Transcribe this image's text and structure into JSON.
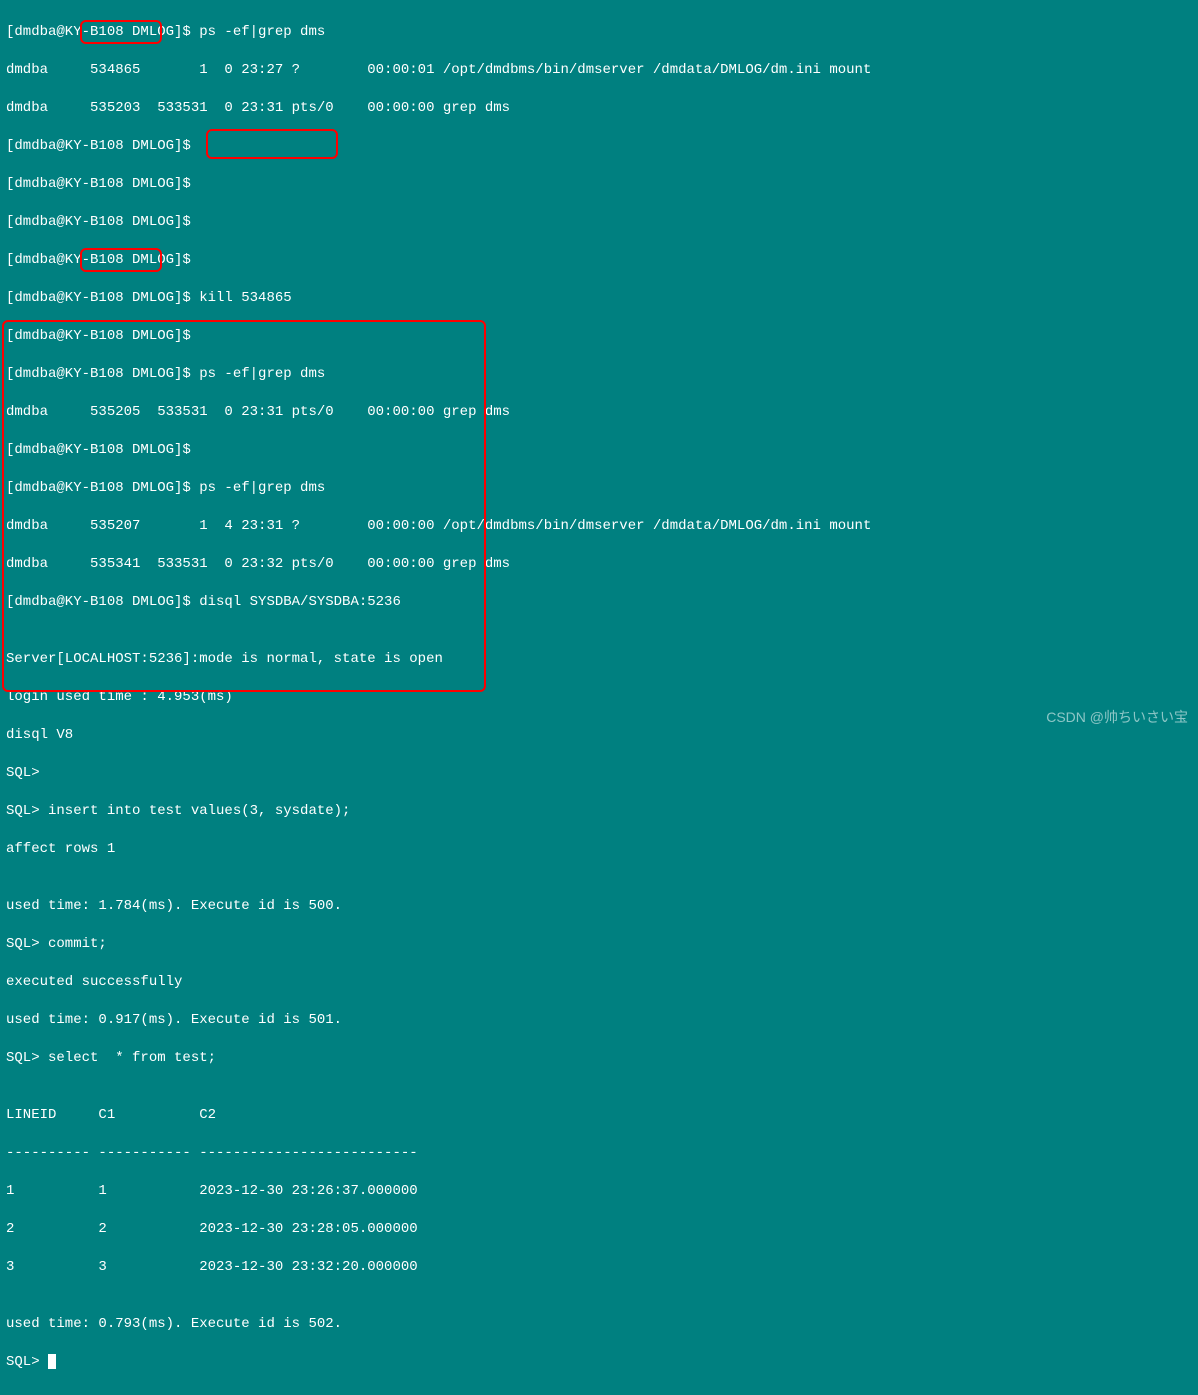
{
  "lines": {
    "l1": "[dmdba@KY-B108 DMLOG]$ ps -ef|grep dms",
    "l2": "dmdba     534865       1  0 23:27 ?        00:00:01 /opt/dmdbms/bin/dmserver /dmdata/DMLOG/dm.ini mount",
    "l3": "dmdba     535203  533531  0 23:31 pts/0    00:00:00 grep dms",
    "l4": "[dmdba@KY-B108 DMLOG]$ ",
    "l5": "[dmdba@KY-B108 DMLOG]$ ",
    "l6": "[dmdba@KY-B108 DMLOG]$ ",
    "l7": "[dmdba@KY-B108 DMLOG]$ ",
    "l8": "[dmdba@KY-B108 DMLOG]$ kill 534865",
    "l9": "[dmdba@KY-B108 DMLOG]$ ",
    "l10": "[dmdba@KY-B108 DMLOG]$ ps -ef|grep dms",
    "l11": "dmdba     535205  533531  0 23:31 pts/0    00:00:00 grep dms",
    "l12": "[dmdba@KY-B108 DMLOG]$ ",
    "l13": "[dmdba@KY-B108 DMLOG]$ ps -ef|grep dms",
    "l14": "dmdba     535207       1  4 23:31 ?        00:00:00 /opt/dmdbms/bin/dmserver /dmdata/DMLOG/dm.ini mount",
    "l15": "dmdba     535341  533531  0 23:32 pts/0    00:00:00 grep dms",
    "l16": "[dmdba@KY-B108 DMLOG]$ disql SYSDBA/SYSDBA:5236",
    "l17": "",
    "l18": "Server[LOCALHOST:5236]:mode is normal, state is open",
    "l19": "login used time : 4.953(ms)",
    "l20": "disql V8",
    "l21": "SQL> ",
    "l22": "SQL> insert into test values(3, sysdate);",
    "l23": "affect rows 1",
    "l24": "",
    "l25": "used time: 1.784(ms). Execute id is 500.",
    "l26": "SQL> commit;",
    "l27": "executed successfully",
    "l28": "used time: 0.917(ms). Execute id is 501.",
    "l29": "SQL> select  * from test;",
    "l30": "",
    "l31": "LINEID     C1          C2                        ",
    "l32": "---------- ----------- --------------------------",
    "l33": "1          1           2023-12-30 23:26:37.000000",
    "l34": "2          2           2023-12-30 23:28:05.000000",
    "l35": "3          3           2023-12-30 23:32:20.000000",
    "l36": "",
    "l37": "used time: 0.793(ms). Execute id is 502.",
    "l38": "SQL> "
  },
  "watermark": "CSDN @帅ちいさい宝",
  "highlights": {
    "pid1": "534865",
    "kill": "kill 534865",
    "pid2": "535207",
    "sqlblock": "disql output"
  }
}
